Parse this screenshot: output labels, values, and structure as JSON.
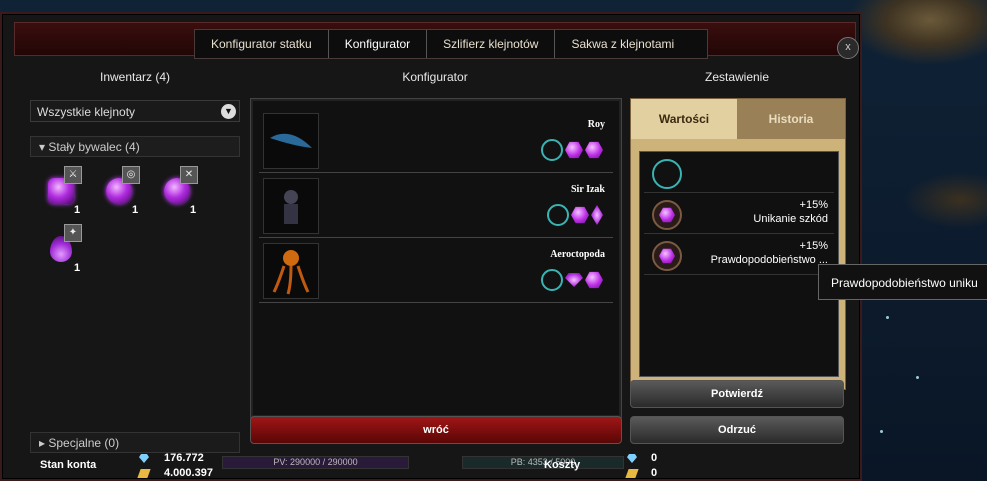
{
  "tabs": [
    {
      "label": "Konfigurator statku"
    },
    {
      "label": "Konfigurator"
    },
    {
      "label": "Szlifierz klejnotów"
    },
    {
      "label": "Sakwa z klejnotami"
    }
  ],
  "close_label": "x",
  "inventory": {
    "header": "Inwentarz (4)",
    "filter_value": "Wszystkie klejnoty",
    "group_open": "Stały bywalec (4)",
    "group_closed": "Specjalne (0)",
    "items": [
      {
        "count": "1",
        "icon": "square-gem-icon"
      },
      {
        "count": "1",
        "icon": "round-gem-icon"
      },
      {
        "count": "1",
        "icon": "round-gem-icon"
      },
      {
        "count": "1",
        "icon": "drop-gem-icon"
      }
    ]
  },
  "configurator": {
    "header": "Konfigurator",
    "crew": [
      {
        "name": "Roy"
      },
      {
        "name": "Sir Izak"
      },
      {
        "name": "Aeroctopoda"
      }
    ],
    "back_label": "wróć"
  },
  "summary": {
    "header": "Zestawienie",
    "tab_active": "Wartości",
    "tab_inactive": "Historia",
    "rows": [
      {
        "line1": "",
        "line2": ""
      },
      {
        "line1": "+15%",
        "line2": "Unikanie szkód"
      },
      {
        "line1": "+15%",
        "line2": "Prawdopodobieństwo ..."
      }
    ],
    "confirm_label": "Potwierdź",
    "reject_label": "Odrzuć"
  },
  "tooltip": "Prawdopodobieństwo uniku",
  "footer": {
    "account_label": "Stan konta",
    "diamonds": "176.772",
    "gold": "4.000.397",
    "costs_label": "Koszty",
    "cost_diamonds": "0",
    "cost_gold": "0",
    "pv": "PV: 290000 / 290000",
    "pb": "PB: 4353 / 5000"
  },
  "colors": {
    "accent_red": "#a01616",
    "gem_purple": "#b12de0",
    "empty_slot_teal": "#3ab3b3",
    "parchment": "#cdb27a"
  }
}
